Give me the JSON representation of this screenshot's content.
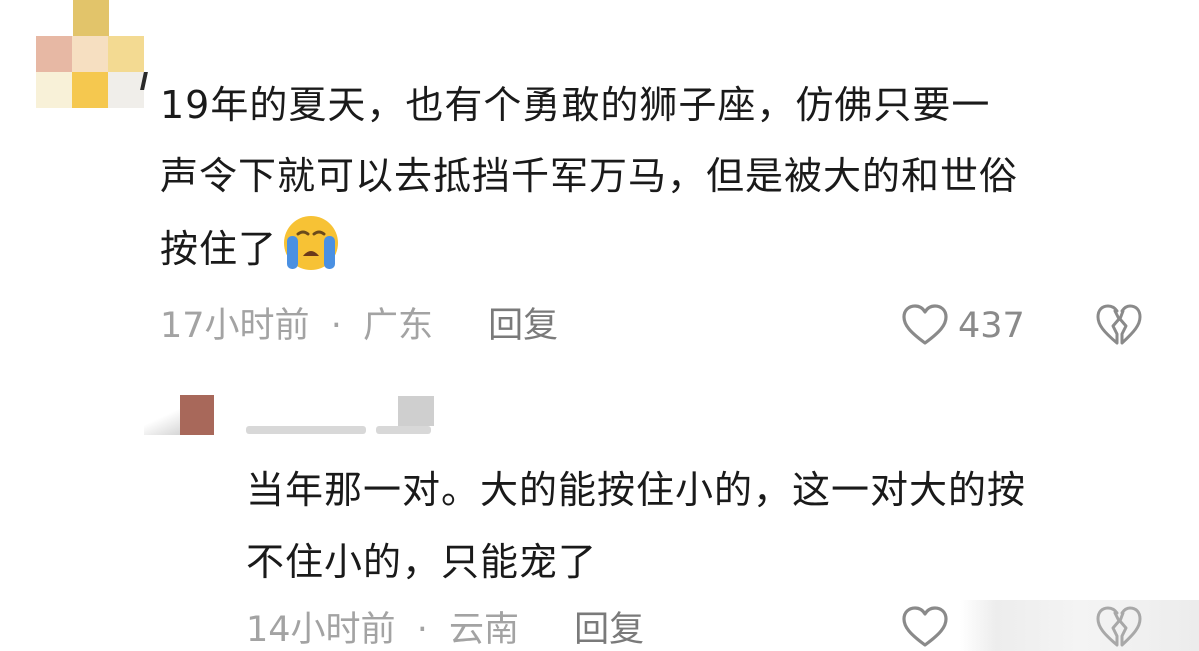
{
  "comments": [
    {
      "text": "19年的夏天，也有个勇敢的狮子座，仿佛只要一\n声令下就可以去抵挡千军万马，但是被大的和世俗\n按住了",
      "emoji": "loudly-crying-face",
      "time": "17小时前",
      "separator": "·",
      "location": "广东",
      "reply_label": "回复",
      "likes": "437"
    },
    {
      "text": "当年那一对。大的能按住小的，这一对大的按\n不住小的，只能宠了",
      "time": "14小时前",
      "separator": "·",
      "location": "云南",
      "reply_label": "回复"
    }
  ],
  "colors": {
    "text": "#1a1a1a",
    "meta": "#a3a3a3",
    "icon": "#8a8a8a",
    "emoji_face": "#f7c235",
    "emoji_tear": "#4a90e2"
  }
}
